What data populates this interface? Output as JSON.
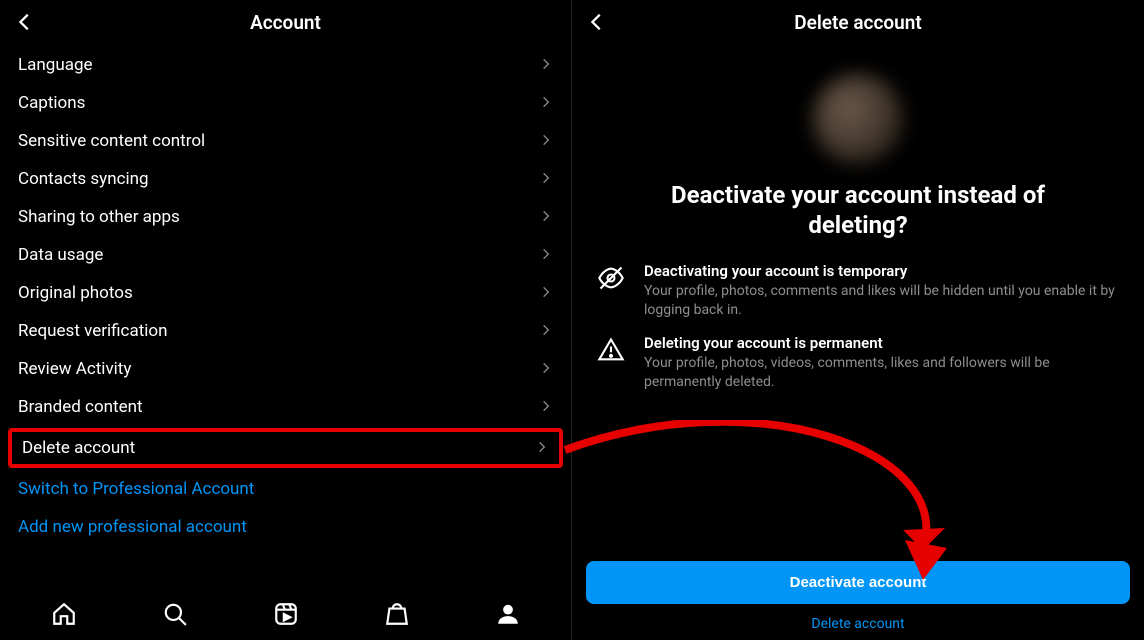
{
  "left": {
    "title": "Account",
    "items": [
      {
        "label": "Language"
      },
      {
        "label": "Captions"
      },
      {
        "label": "Sensitive content control"
      },
      {
        "label": "Contacts syncing"
      },
      {
        "label": "Sharing to other apps"
      },
      {
        "label": "Data usage"
      },
      {
        "label": "Original photos"
      },
      {
        "label": "Request verification"
      },
      {
        "label": "Review Activity"
      },
      {
        "label": "Branded content"
      },
      {
        "label": "Delete account"
      }
    ],
    "links": [
      {
        "label": "Switch to Professional Account"
      },
      {
        "label": "Add new professional account"
      }
    ]
  },
  "right": {
    "title": "Delete account",
    "headline": "Deactivate your account instead of deleting?",
    "deactivate": {
      "title": "Deactivating your account is temporary",
      "body": "Your profile, photos, comments and likes will be hidden until you enable it by logging back in."
    },
    "delete": {
      "title": "Deleting your account is permanent",
      "body": "Your profile, photos, videos, comments, likes and followers will be permanently deleted."
    },
    "primary_btn": "Deactivate account",
    "secondary_link": "Delete account"
  },
  "annotation": {
    "highlight_item": "Delete account"
  }
}
